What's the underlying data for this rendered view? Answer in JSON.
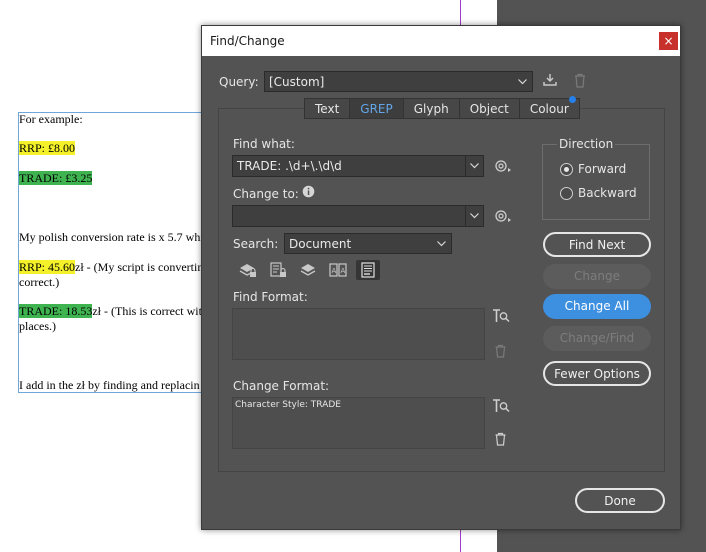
{
  "document": {
    "lines": [
      {
        "text": "For example:"
      },
      {
        "highlight": "RRP: £8.00"
      },
      {
        "highlight": "TRADE: £3.25"
      },
      {
        "text": "My polish conversion rate is x 5.7 whi"
      },
      {
        "highlight": "RRP: 45.60",
        "text": "zł  - (My script is convertin"
      },
      {
        "text": "correct.)"
      },
      {
        "highlight": "TRADE: 18.53",
        "text": "zł  - (This is correct wit"
      },
      {
        "text": "places.)"
      },
      {
        "text": "I add in the zł by finding and replacin"
      }
    ]
  },
  "dialog": {
    "title": "Find/Change",
    "close": "×",
    "query_label": "Query:",
    "query_value": "[Custom]",
    "tabs": [
      "Text",
      "GREP",
      "Glyph",
      "Object",
      "Colour"
    ],
    "active_tab": "GREP",
    "find_what_label": "Find what:",
    "find_what_value": "TRADE: .\\d+\\.\\d\\d",
    "change_to_label": "Change to:",
    "change_to_value": "",
    "search_label": "Search:",
    "search_value": "Document",
    "find_format_label": "Find Format:",
    "change_format_label": "Change Format:",
    "change_format_value": "Character Style: TRADE",
    "direction": {
      "label": "Direction",
      "forward": "Forward",
      "backward": "Backward",
      "selected": "Forward"
    },
    "buttons": {
      "find_next": "Find Next",
      "change": "Change",
      "change_all": "Change All",
      "change_find": "Change/Find",
      "fewer_options": "Fewer Options",
      "done": "Done"
    },
    "colors": {
      "accent": "#3d8fe0",
      "tab_active": "#62a6e8",
      "dialog_bg": "#535353"
    }
  }
}
